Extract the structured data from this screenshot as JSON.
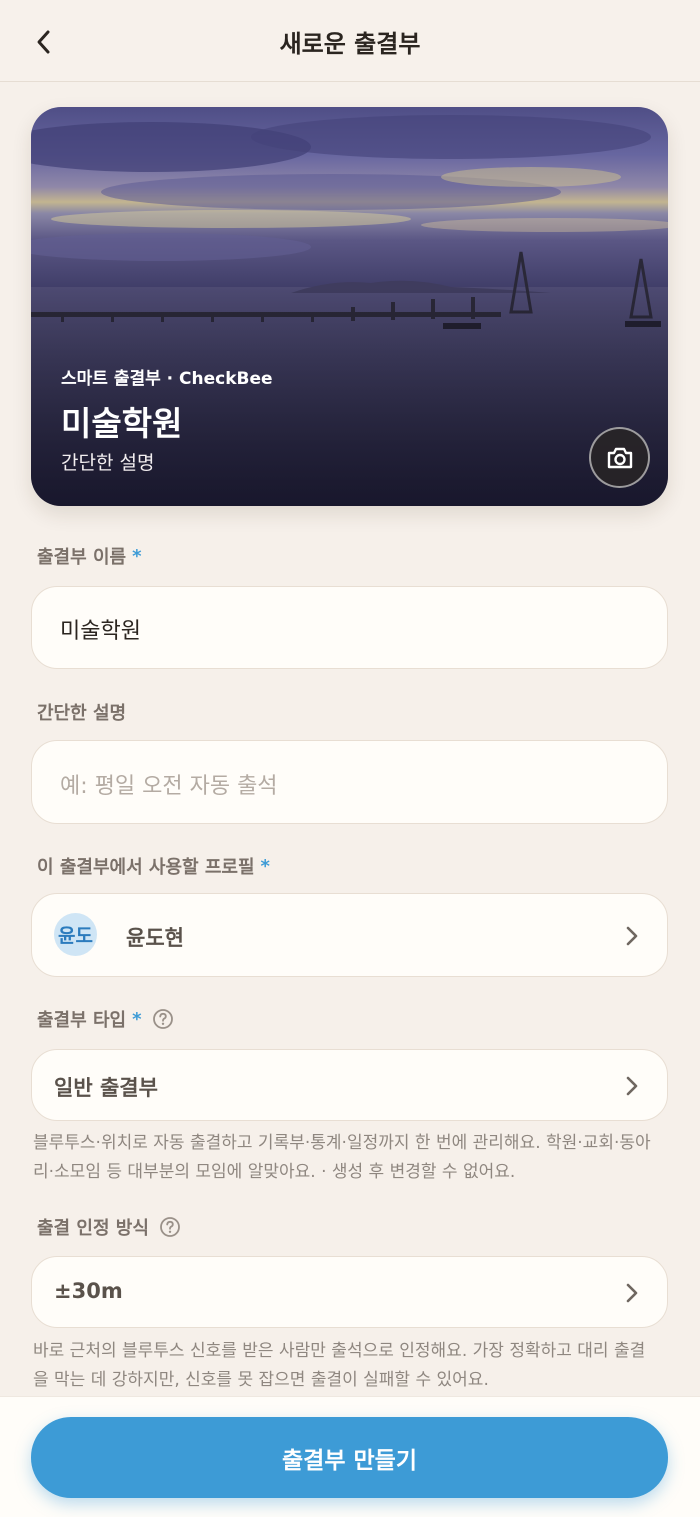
{
  "header": {
    "title": "새로운 출결부"
  },
  "cover": {
    "subtitle": "스마트 출결부 · CheckBee",
    "title": "미술학원",
    "description": "간단한 설명"
  },
  "form": {
    "name": {
      "label": "출결부 이름",
      "required_mark": "*",
      "value": "미술학원"
    },
    "description": {
      "label": "간단한 설명",
      "placeholder": "예: 평일 오전 자동 출석"
    },
    "profile": {
      "label": "이 출결부에서 사용할 프로필",
      "required_mark": "*",
      "avatar_text": "윤도",
      "name": "윤도현"
    },
    "type": {
      "label": "출결부 타입",
      "required_mark": "*",
      "value": "일반 출결부",
      "help_line1": "블루투스·위치로 자동 출결하고 기록부·통계·일정까지 한 번에 관리해요. 학원·교회·동아",
      "help_line2": "리·소모임 등 대부분의 모임에 알맞아요. · 생성 후 변경할 수 없어요."
    },
    "method": {
      "label": "출결 인정 방식",
      "value": "±30m",
      "help_line1": "바로 근처의 블루투스 신호를 받은 사람만 출석으로 인정해요. 가장 정확하고 대리 출결",
      "help_line2": "을 막는 데 강하지만, 신호를 못 잡으면 출결이 실패할 수 있어요."
    }
  },
  "footer": {
    "cta_label": "출결부 만들기"
  },
  "colors": {
    "accent": "#3d9bd6",
    "background": "#f6f0ea",
    "card": "#fffdf9"
  }
}
